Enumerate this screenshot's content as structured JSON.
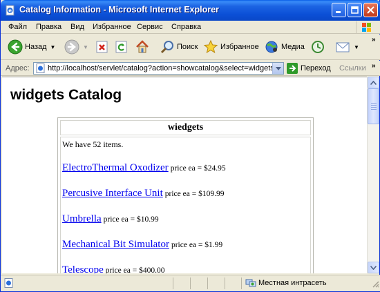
{
  "window": {
    "title": "Catalog Information - Microsoft Internet Explorer"
  },
  "menu": {
    "items": [
      {
        "label": "Файл"
      },
      {
        "label": "Правка"
      },
      {
        "label": "Вид"
      },
      {
        "label": "Избранное"
      },
      {
        "label": "Сервис"
      },
      {
        "label": "Справка"
      }
    ]
  },
  "toolbar": {
    "back_label": "Назад",
    "search_label": "Поиск",
    "favorites_label": "Избранное",
    "media_label": "Медиа",
    "more": "»"
  },
  "address": {
    "label": "Адрес:",
    "url": "http://localhost/servlet/catalog?action=showcatalog&select=widgets",
    "go_label": "Переход",
    "links_label": "Ссылки",
    "more": "»"
  },
  "page": {
    "heading": "widgets Catalog",
    "table_header": "wiedgets",
    "count_text": "We have 52 items.",
    "items": [
      {
        "name": "ElectroThermal Oxodizer",
        "price": "price ea = $24.95"
      },
      {
        "name": "Percusive Interface Unit",
        "price": "price ea = $109.99"
      },
      {
        "name": "Umbrella",
        "price": "price ea = $10.99"
      },
      {
        "name": "Mechanical Bit Simulator",
        "price": "price ea = $1.99"
      },
      {
        "name": "Telescope",
        "price": "price ea = $400.00"
      }
    ]
  },
  "status": {
    "zone_label": "Местная интрасеть"
  },
  "colors": {
    "titlebar": "#0b4fd6",
    "link": "#0000ee",
    "chrome": "#ece9d8"
  }
}
